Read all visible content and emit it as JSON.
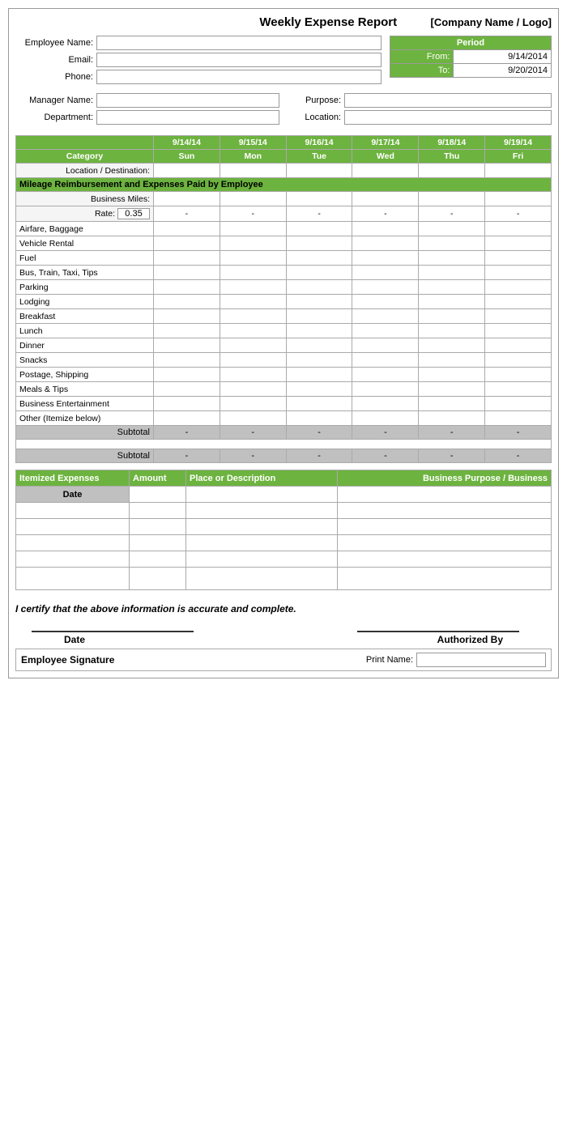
{
  "header": {
    "title": "Weekly Expense Report",
    "company": "[Company Name / Logo]"
  },
  "employee": {
    "name_label": "Employee Name:",
    "email_label": "Email:",
    "phone_label": "Phone:",
    "manager_label": "Manager Name:",
    "department_label": "Department:",
    "purpose_label": "Purpose:",
    "location_label": "Location:"
  },
  "period": {
    "header": "Period",
    "from_label": "From:",
    "from_value": "9/14/2014",
    "to_label": "To:",
    "to_value": "9/20/2014"
  },
  "table": {
    "category_label": "Category",
    "days": [
      {
        "date": "9/14/14",
        "day": "Sun"
      },
      {
        "date": "9/15/14",
        "day": "Mon"
      },
      {
        "date": "9/16/14",
        "day": "Tue"
      },
      {
        "date": "9/17/14",
        "day": "Wed"
      },
      {
        "date": "9/18/14",
        "day": "Thu"
      },
      {
        "date": "9/19/14",
        "day": "Fri"
      }
    ],
    "location_label": "Location / Destination:",
    "mileage_section": "Mileage Reimbursement and Expenses Paid by Employee",
    "business_miles_label": "Business Miles:",
    "rate_label": "Rate:",
    "rate_value": "0.35",
    "dash": "-",
    "categories": [
      "Airfare, Baggage",
      "Vehicle Rental",
      "Fuel",
      "Bus, Train, Taxi, Tips",
      "Parking",
      "Lodging",
      "Breakfast",
      "Lunch",
      "Dinner",
      "Snacks",
      "Postage, Shipping",
      "Meals & Tips",
      "Business Entertainment",
      "Other (Itemize below)"
    ],
    "subtotal_label": "Subtotal",
    "subtotal_values": [
      "-",
      "-",
      "-",
      "-",
      "-",
      "-"
    ]
  },
  "itemized": {
    "header": "Itemized Expenses",
    "amount_col": "Amount",
    "place_col": "Place or Description",
    "business_col": "Business Purpose / Business",
    "date_col": "Date",
    "rows": 6
  },
  "certification": {
    "text": "I certify that the above information is accurate and complete."
  },
  "signature": {
    "date_label": "Date",
    "authorized_label": "Authorized By",
    "employee_sig_label": "Employee Signature",
    "print_name_label": "Print Name:"
  }
}
